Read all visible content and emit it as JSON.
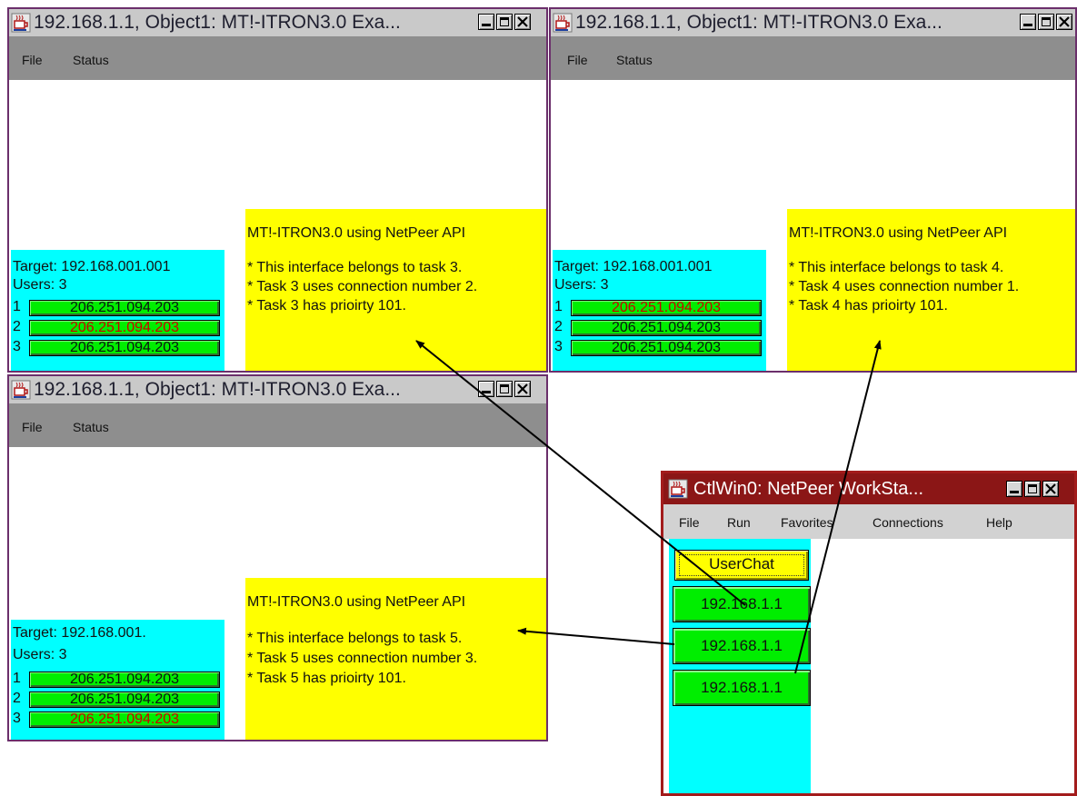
{
  "windows": [
    {
      "title": "192.168.1.1, Object1: MT!-ITRON3.0 Exa...",
      "menu": [
        "File",
        "Status"
      ],
      "target": "Target: 192.168.001.001",
      "users": "Users: 3",
      "rows": [
        {
          "num": "1",
          "ip": "206.251.094.203",
          "highlight": false
        },
        {
          "num": "2",
          "ip": "206.251.094.203",
          "highlight": true
        },
        {
          "num": "3",
          "ip": "206.251.094.203",
          "highlight": false
        }
      ],
      "info_title": "MT!-ITRON3.0 using NetPeer API",
      "info_lines": [
        "* This interface belongs to task 3.",
        "* Task 3 uses connection number 2.",
        "* Task 3 has prioirty 101."
      ]
    },
    {
      "title": "192.168.1.1, Object1: MT!-ITRON3.0 Exa...",
      "menu": [
        "File",
        "Status"
      ],
      "target": "Target: 192.168.001.001",
      "users": "Users: 3",
      "rows": [
        {
          "num": "1",
          "ip": "206.251.094.203",
          "highlight": true
        },
        {
          "num": "2",
          "ip": "206.251.094.203",
          "highlight": false
        },
        {
          "num": "3",
          "ip": "206.251.094.203",
          "highlight": false
        }
      ],
      "info_title": "MT!-ITRON3.0 using NetPeer API",
      "info_lines": [
        "* This interface belongs to task 4.",
        "* Task 4 uses connection number 1.",
        "* Task 4 has prioirty 101."
      ]
    },
    {
      "title": "192.168.1.1, Object1: MT!-ITRON3.0 Exa...",
      "menu": [
        "File",
        "Status"
      ],
      "target": "Target: 192.168.001.",
      "users": "Users: 3",
      "rows": [
        {
          "num": "1",
          "ip": "206.251.094.203",
          "highlight": false
        },
        {
          "num": "2",
          "ip": "206.251.094.203",
          "highlight": false
        },
        {
          "num": "3",
          "ip": "206.251.094.203",
          "highlight": true
        }
      ],
      "info_title": "MT!-ITRON3.0 using NetPeer API",
      "info_lines": [
        "* This interface belongs to task 5.",
        "* Task 5 uses connection number 3.",
        "* Task 5 has prioirty 101."
      ]
    }
  ],
  "control": {
    "title": "CtlWin0: NetPeer WorkSta...",
    "menu": [
      "File",
      "Run",
      "Favorites",
      "Connections",
      "Help"
    ],
    "userchat_label": "UserChat",
    "connections": [
      "192.168.1.1",
      "192.168.1.1",
      "192.168.1.1"
    ]
  },
  "colors": {
    "window_border": "#6b2f6b",
    "control_border": "#a31c1c",
    "panel_cyan": "#00ffff",
    "panel_yellow": "#ffff00",
    "button_green": "#00ee00",
    "highlight_text": "#cc0000"
  },
  "icons": [
    "java-cup-icon",
    "minimize-icon",
    "maximize-icon",
    "close-icon"
  ]
}
